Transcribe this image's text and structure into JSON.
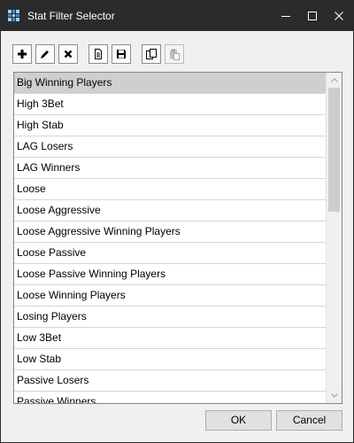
{
  "window": {
    "title": "Stat Filter Selector",
    "app_icon": "grid-app-icon",
    "controls": [
      "minimize-icon",
      "maximize-icon",
      "close-icon"
    ]
  },
  "toolbar": {
    "buttons": [
      {
        "name": "add-filter-button",
        "icon": "plus-icon",
        "enabled": true
      },
      {
        "name": "edit-filter-button",
        "icon": "pencil-icon",
        "enabled": true
      },
      {
        "name": "delete-filter-button",
        "icon": "x-icon",
        "enabled": true
      },
      {
        "name": "new-document-button",
        "icon": "document-icon",
        "enabled": true
      },
      {
        "name": "save-button",
        "icon": "floppy-disk-icon",
        "enabled": true
      },
      {
        "name": "copy-button",
        "icon": "copy-icon",
        "enabled": true
      },
      {
        "name": "paste-button",
        "icon": "paste-icon",
        "enabled": false
      }
    ]
  },
  "filter_list": {
    "selected_index": 0,
    "items": [
      "Big Winning Players",
      "High 3Bet",
      "High Stab",
      "LAG Losers",
      "LAG Winners",
      "Loose",
      "Loose Aggressive",
      "Loose Aggressive Winning Players",
      "Loose Passive",
      "Loose Passive Winning Players",
      "Loose Winning Players",
      "Losing Players",
      "Low 3Bet",
      "Low Stab",
      "Passive Losers",
      "Passive Winners"
    ]
  },
  "footer": {
    "ok_label": "OK",
    "cancel_label": "Cancel"
  },
  "colors": {
    "titlebar": "#2b2b2b",
    "selected_row": "#cfcfcf",
    "app_icon_blue": "#3a8fd9"
  }
}
